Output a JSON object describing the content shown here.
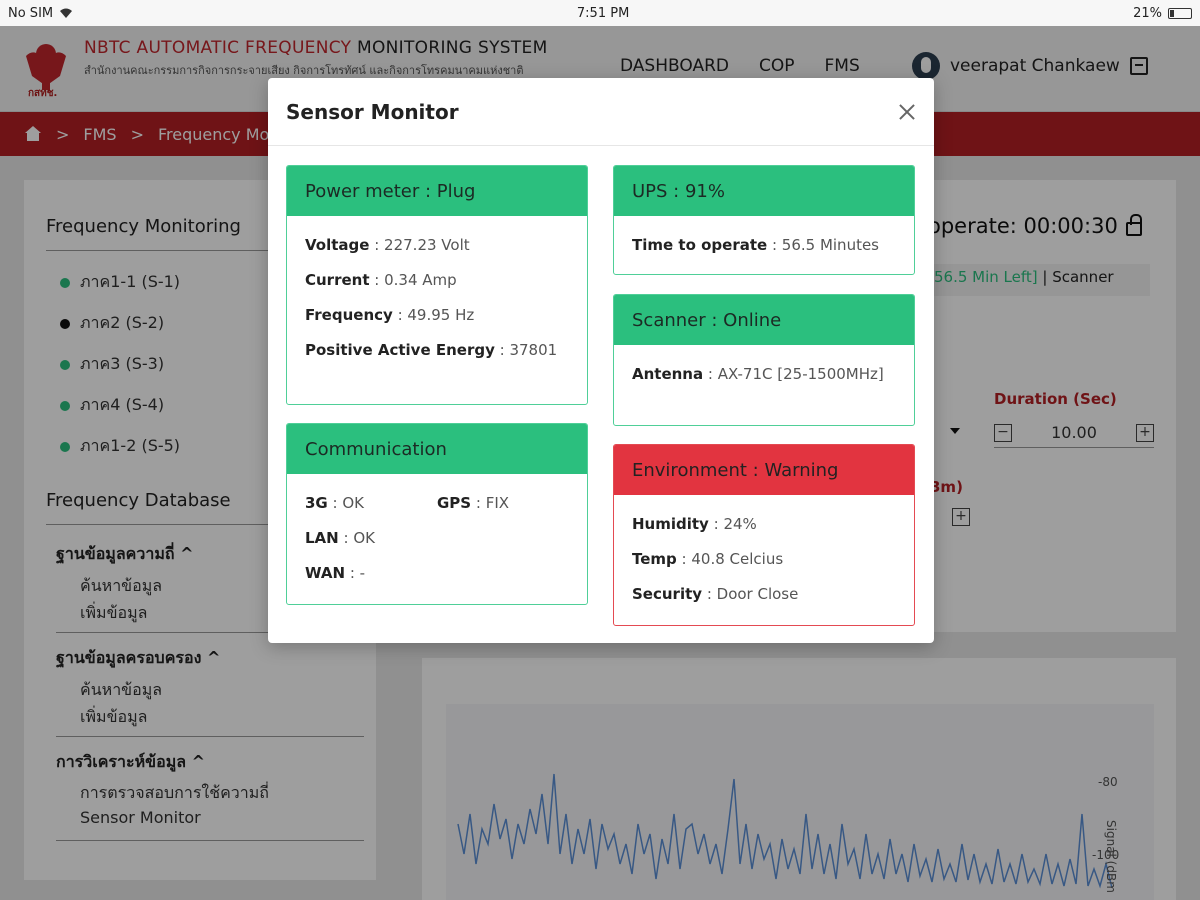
{
  "status_bar": {
    "carrier": "No SIM",
    "time": "7:51 PM",
    "battery": "21%",
    "battery_level": 0.21
  },
  "header": {
    "title_red": "NBTC AUTOMATIC FREQUENCY",
    "title_dark": "MONITORING SYSTEM",
    "subtitle": "สำนักงานคณะกรรมการกิจการกระจายเสียง กิจการโทรทัศน์ และกิจการโทรคมนาคมแห่งชาติ",
    "logo_caption": "กสทช.",
    "nav": [
      "DASHBOARD",
      "COP",
      "FMS"
    ],
    "user_name": "veerapat Chankaew"
  },
  "breadcrumb": {
    "items": [
      "FMS",
      "Frequency Mo"
    ],
    "separator": ">"
  },
  "sidebar": {
    "monitoring_title": "Frequency Monitoring",
    "stations": [
      {
        "label": "ภาค1-1 (S-1)",
        "status": "online"
      },
      {
        "label": "ภาค2 (S-2)",
        "status": "offline"
      },
      {
        "label": "ภาค3 (S-3)",
        "status": "online"
      },
      {
        "label": "ภาค4 (S-4)",
        "status": "online"
      },
      {
        "label": "ภาค1-2 (S-5)",
        "status": "online"
      }
    ],
    "database_title": "Frequency Database",
    "groups": [
      {
        "title": "ฐานข้อมูลความถี่",
        "items": [
          "ค้นหาข้อมูล",
          "เพิ่มข้อมูล"
        ]
      },
      {
        "title": "ฐานข้อมูลครอบครอง",
        "items": [
          "ค้นหาข้อมูล",
          "เพิ่มข้อมูล"
        ]
      },
      {
        "title": "การวิเคราะห์ข้อมูล",
        "items": [
          "การตรวจสอบการใช้ความถี่",
          "Sensor Monitor"
        ]
      }
    ],
    "caret_up": "^"
  },
  "right_panel": {
    "operate_label": "operate: 00:00:30",
    "scanner_time_left": "56.5 Min Left]",
    "scanner_sep": " | ",
    "scanner_label": "Scanner",
    "duration_label": "Duration (Sec)",
    "duration_value": "10.00",
    "dbm_label": "3m)",
    "minus": "−",
    "plus": "+",
    "chart_ticks": [
      "-80",
      "-100"
    ],
    "chart_axis_label": "Signal (dBm"
  },
  "modal": {
    "title": "Sensor Monitor",
    "power": {
      "header": "Power meter : Plug",
      "rows": [
        {
          "label": "Voltage",
          "value": "227.23 Volt"
        },
        {
          "label": "Current",
          "value": "0.34 Amp"
        },
        {
          "label": "Frequency",
          "value": "49.95 Hz"
        },
        {
          "label": "Positive Active Energy",
          "value": "37801"
        }
      ]
    },
    "ups": {
      "header": "UPS : 91%",
      "rows": [
        {
          "label": "Time to operate",
          "value": "56.5 Minutes"
        }
      ]
    },
    "scanner": {
      "header": "Scanner : Online",
      "rows": [
        {
          "label": "Antenna",
          "value": "AX-71C [25-1500MHz]"
        }
      ]
    },
    "communication": {
      "header": "Communication",
      "rows": [
        {
          "label": "3G",
          "value": "OK"
        },
        {
          "label": "GPS",
          "value": "FIX"
        },
        {
          "label": "LAN",
          "value": "OK"
        },
        {
          "label": "WAN",
          "value": "-"
        }
      ]
    },
    "environment": {
      "header": "Environment : Warning",
      "rows": [
        {
          "label": "Humidity",
          "value": "24%"
        },
        {
          "label": "Temp",
          "value": "40.8 Celcius"
        },
        {
          "label": "Security",
          "value": "Door Close"
        }
      ]
    },
    "separator": " : "
  },
  "colors": {
    "brand_red": "#b31f24",
    "ok_green": "#2bbf7e",
    "warn_red": "#e23440"
  }
}
